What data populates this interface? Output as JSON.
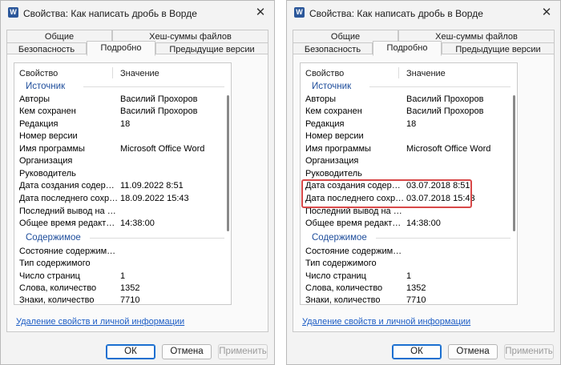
{
  "left": {
    "title": "Свойства: Как написать дробь в Ворде",
    "app_icon": "W",
    "close": "✕",
    "tabs": {
      "general": "Общие",
      "hashes": "Хеш-суммы файлов",
      "security": "Безопасность",
      "details": "Подробно",
      "previous": "Предыдущие версии"
    },
    "header": {
      "property": "Свойство",
      "value": "Значение"
    },
    "source": "Источник",
    "authors": {
      "label": "Авторы",
      "value": "Василий Прохоров"
    },
    "saved_by": {
      "label": "Кем сохранен",
      "value": "Василий Прохоров"
    },
    "revision": {
      "label": "Редакция",
      "value": "18"
    },
    "version": {
      "label": "Номер версии"
    },
    "program": {
      "label": "Имя программы",
      "value": "Microsoft Office Word"
    },
    "company": {
      "label": "Организация"
    },
    "manager": {
      "label": "Руководитель"
    },
    "created": {
      "label": "Дата создания содержимого",
      "value": "11.09.2022 8:51"
    },
    "saved": {
      "label": "Дата последнего сохранения",
      "value": "18.09.2022 15:43"
    },
    "printed": {
      "label": "Последний вывод на печать"
    },
    "editing_time": {
      "label": "Общее время редактирования",
      "value": "14:38:00"
    },
    "content": "Содержимое",
    "content_status": {
      "label": "Состояние содержимого"
    },
    "content_type": {
      "label": "Тип содержимого"
    },
    "pages": {
      "label": "Число страниц",
      "value": "1"
    },
    "words": {
      "label": "Слова, количество",
      "value": "1352"
    },
    "chars": {
      "label": "Знаки, количество",
      "value": "7710"
    },
    "link": "Удаление свойств и личной информации",
    "ok": "ОК",
    "cancel": "Отмена",
    "apply": "Применить"
  },
  "right": {
    "title": "Свойства: Как написать дробь в Ворде",
    "app_icon": "W",
    "close": "✕",
    "tabs": {
      "general": "Общие",
      "hashes": "Хеш-суммы файлов",
      "security": "Безопасность",
      "details": "Подробно",
      "previous": "Предыдущие версии"
    },
    "header": {
      "property": "Свойство",
      "value": "Значение"
    },
    "source": "Источник",
    "authors": {
      "label": "Авторы",
      "value": "Василий Прохоров"
    },
    "saved_by": {
      "label": "Кем сохранен",
      "value": "Василий Прохоров"
    },
    "revision": {
      "label": "Редакция",
      "value": "18"
    },
    "version": {
      "label": "Номер версии"
    },
    "program": {
      "label": "Имя программы",
      "value": "Microsoft Office Word"
    },
    "company": {
      "label": "Организация"
    },
    "manager": {
      "label": "Руководитель"
    },
    "created": {
      "label": "Дата создания содержимого",
      "value": "03.07.2018 8:51"
    },
    "saved": {
      "label": "Дата последнего сохранения",
      "value": "03.07.2018 15:43"
    },
    "printed": {
      "label": "Последний вывод на печать"
    },
    "editing_time": {
      "label": "Общее время редактирования",
      "value": "14:38:00"
    },
    "content": "Содержимое",
    "content_status": {
      "label": "Состояние содержимого"
    },
    "content_type": {
      "label": "Тип содержимого"
    },
    "pages": {
      "label": "Число страниц",
      "value": "1"
    },
    "words": {
      "label": "Слова, количество",
      "value": "1352"
    },
    "chars": {
      "label": "Знаки, количество",
      "value": "7710"
    },
    "link": "Удаление свойств и личной информации",
    "ok": "ОК",
    "cancel": "Отмена",
    "apply": "Применить"
  },
  "colors": {
    "group_heading": "#1e4d9b",
    "link": "#1a5bc4",
    "highlight": "#d84848",
    "ok_border": "#1a6fd0"
  }
}
